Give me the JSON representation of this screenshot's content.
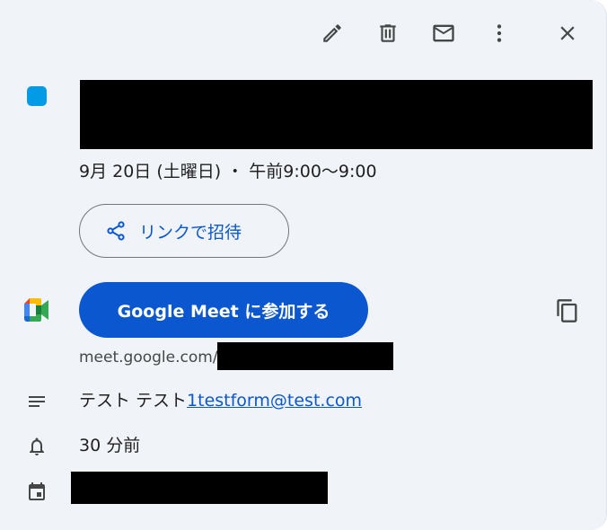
{
  "toolbar": {
    "edit_icon": "pencil-icon",
    "delete_icon": "trash-icon",
    "email_icon": "mail-icon",
    "more_icon": "more-vert-icon",
    "close_icon": "close-icon"
  },
  "event": {
    "color": "#039be5",
    "title_redacted": true,
    "datetime": "9月 20日 (土曜日) ・ 午前9:00〜9:00"
  },
  "share": {
    "label": "リンクで招待",
    "icon": "share-icon"
  },
  "meet": {
    "join_label": "Google Meet に参加する",
    "url_prefix": "meet.google.com/",
    "copy_icon": "copy-icon",
    "logo_icon": "google-meet-logo"
  },
  "description": {
    "text": "テスト テスト",
    "link": "1testform@test.com",
    "icon": "notes-icon"
  },
  "reminder": {
    "text": "30 分前",
    "icon": "bell-icon"
  },
  "calendar": {
    "icon": "calendar-icon",
    "name_redacted": true
  },
  "colors": {
    "panel_bg": "#f0f4f9",
    "accent": "#0b57d0",
    "text": "#1f1f1f",
    "icon": "#444746"
  }
}
